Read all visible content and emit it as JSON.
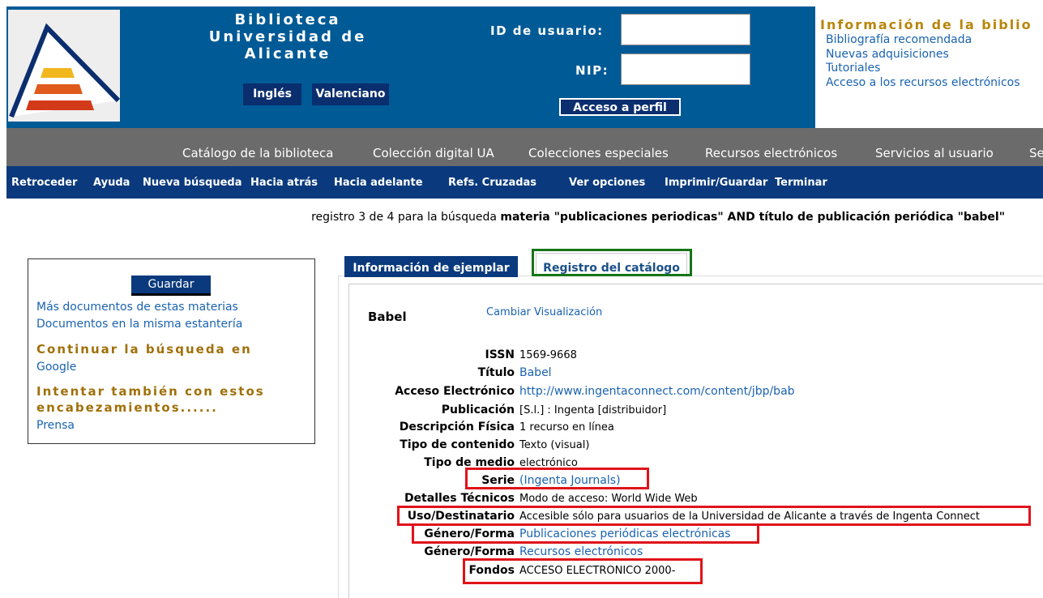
{
  "header": {
    "title_line1": "Biblioteca",
    "title_line2": "Universidad de Alicante",
    "lang_buttons": [
      "Inglés",
      "Valenciano"
    ],
    "user_id_label": "ID de usuario:",
    "user_id_value": "",
    "nip_label": "NIP:",
    "nip_value": "",
    "profile_button": "Acceso a perfil"
  },
  "info_panel": {
    "title": "Información de la biblio",
    "links": [
      "Bibliografía recomendada",
      "Nuevas adquisiciones",
      "Tutoriales",
      "Acceso a los recursos electrónicos"
    ]
  },
  "nav": {
    "items": [
      "Catálogo de la biblioteca",
      "Colección digital UA",
      "Colecciones especiales",
      "Recursos electrónicos",
      "Servicios al usuario",
      "Se"
    ]
  },
  "toolbar": {
    "items": [
      "Retroceder",
      "Ayuda",
      "Nueva búsqueda",
      "Hacia atrás",
      "Hacia adelante",
      "Refs. Cruzadas",
      "Ver opciones",
      "Imprimir/Guardar",
      "Terminar"
    ]
  },
  "search": {
    "prefix": "registro 3 de 4 para la búsqueda ",
    "query": "materia \"publicaciones periodicas\" AND título de publicación periódica \"babel\""
  },
  "sidebar": {
    "save_button": "Guardar",
    "link_materias": "Más documentos de estas materias",
    "link_estanteria": "Documentos en la misma estantería",
    "continue_heading": "Continuar la búsqueda en",
    "link_google": "Google",
    "try_heading": "Intentar también con estos encabezamientos......",
    "link_prensa": "Prensa"
  },
  "tabs": {
    "ejemplar": "Información de ejemplar",
    "catalogo": "Registro del catálogo"
  },
  "record": {
    "title": "Babel",
    "change_view": "Cambiar Visualización",
    "fields": [
      {
        "label": "ISSN",
        "value": "1569-9668"
      },
      {
        "label": "Título",
        "value": "Babel"
      },
      {
        "label": "Acceso Electrónico",
        "value": "http://www.ingentaconnect.com/content/jbp/bab"
      },
      {
        "label": "Publicación",
        "value": "[S.l.] : Ingenta [distribuidor]"
      },
      {
        "label": "Descripción Física",
        "value": "1 recurso en línea"
      },
      {
        "label": "Tipo de contenido",
        "value": "Texto (visual)"
      },
      {
        "label": "Tipo de medio",
        "value": "electrónico"
      },
      {
        "label": "Serie",
        "value": "(Ingenta Journals)"
      },
      {
        "label": "Detalles Técnicos",
        "value": "Modo de acceso: World Wide Web"
      },
      {
        "label": "Uso/Destinatario",
        "value": "Accesible sólo para usuarios de la Universidad de Alicante a través de Ingenta Connect"
      },
      {
        "label": "Género/Forma",
        "value": "Publicaciones periódicas electrónicas"
      },
      {
        "label": "Género/Forma",
        "value": "Recursos electrónicos"
      },
      {
        "label": "Fondos",
        "value": "ACCESO ELECTRONICO 2000-"
      }
    ]
  },
  "colors": {
    "header_blue": "#005a96",
    "nav_gray": "#6b6b6b",
    "toolbar_navy": "#0a3a7d",
    "highlight_red": "#e0131a",
    "highlight_green": "#167516",
    "link_blue": "#1a63b0",
    "heading_gold": "#a0700a"
  }
}
